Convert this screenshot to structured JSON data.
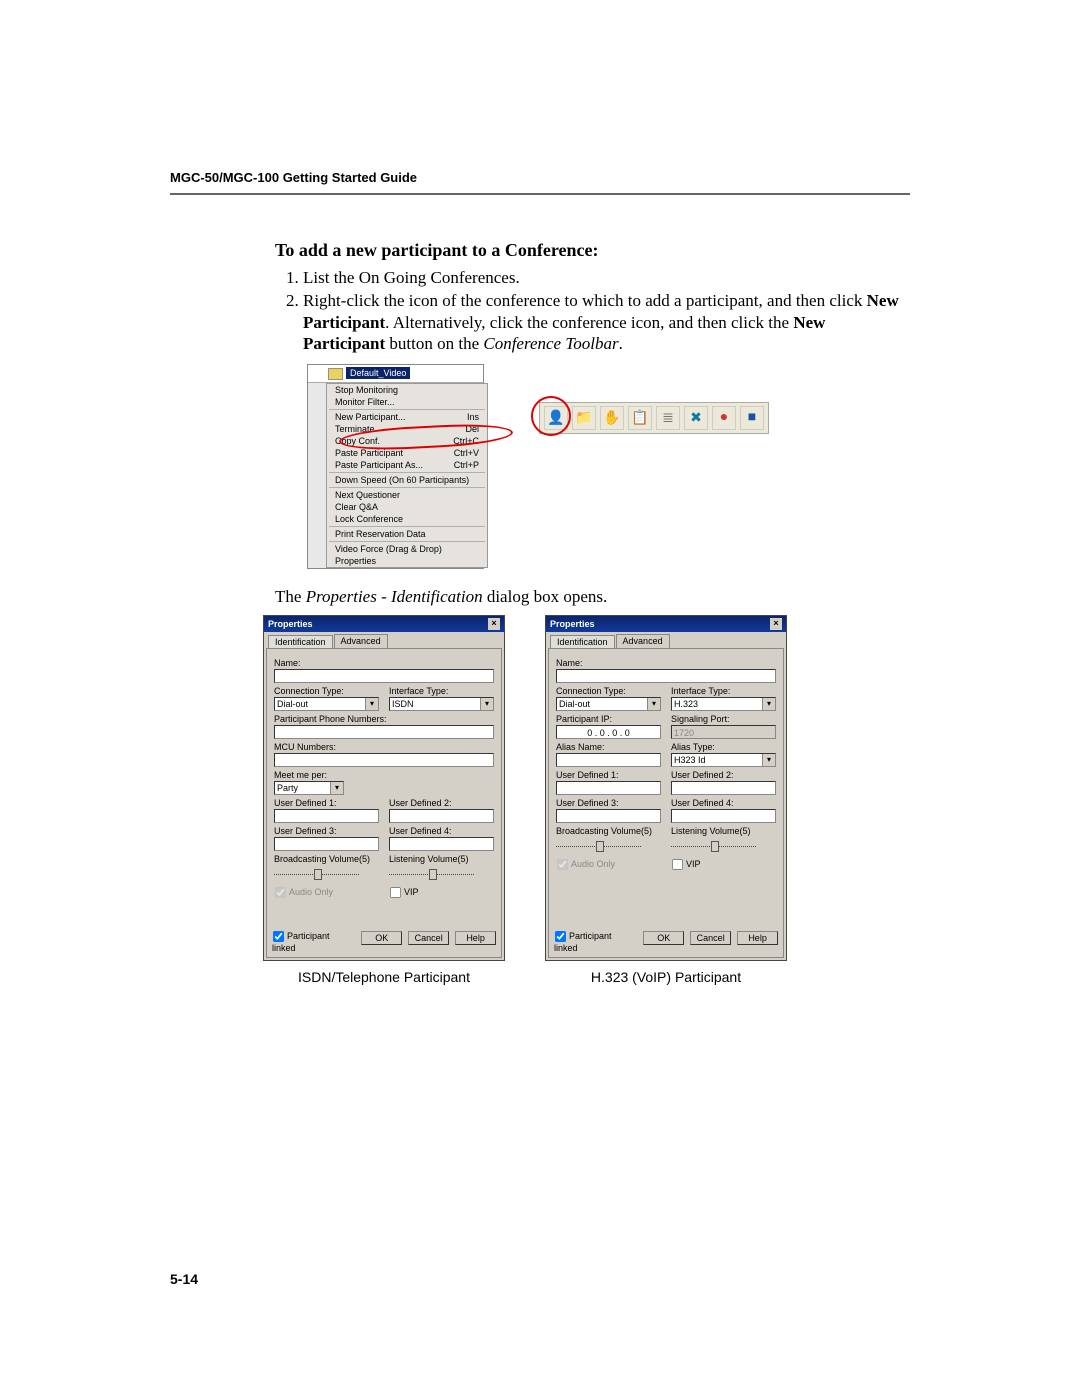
{
  "header": "MGC-50/MGC-100 Getting Started Guide",
  "section_heading": "To add a new participant to a Conference:",
  "step1": "List the On Going Conferences.",
  "step2_a": "Right-click the icon of the conference to which to add a participant, and then click ",
  "step2_b": "New Participant",
  "step2_c": ". Alternatively, click the conference icon, and then click the ",
  "step2_d": "New Participant",
  "step2_e": " button on the ",
  "step2_f": "Conference Toolbar",
  "step2_g": ".",
  "tree_selected": "Default_Video",
  "ctx": {
    "stop_monitoring": "Stop Monitoring",
    "monitor_filter": "Monitor Filter...",
    "new_participant": "New Participant...",
    "new_participant_sc": "Ins",
    "terminate": "Terminate",
    "terminate_sc": "Del",
    "copy_conf": "Copy Conf.",
    "copy_conf_sc": "Ctrl+C",
    "paste_participant": "Paste Participant",
    "paste_participant_sc": "Ctrl+V",
    "paste_participant_as": "Paste Participant As...",
    "paste_participant_as_sc": "Ctrl+P",
    "down_speed": "Down Speed (On 60 Participants)",
    "next_questioner": "Next Questioner",
    "clear_qa": "Clear Q&A",
    "lock_conference": "Lock Conference",
    "print_reservation": "Print Reservation Data",
    "video_force": "Video Force (Drag & Drop)",
    "properties": "Properties"
  },
  "toolbar_icons": {
    "participant": "participant-icon",
    "folder": "folder-icon",
    "hand": "hand-icon",
    "clipboard": "clipboard-icon",
    "bullet": "bullet-icon",
    "xpeople": "cross-people-icon",
    "circle": "red-circle-icon",
    "square": "blue-square-icon"
  },
  "dialog_opens_a": "The ",
  "dialog_opens_b": "Properties - Identification",
  "dialog_opens_c": " dialog box opens.",
  "dialog": {
    "title": "Properties",
    "tab_identification": "Identification",
    "tab_advanced": "Advanced",
    "name": "Name:",
    "connection_type": "Connection Type:",
    "dial_out": "Dial-out",
    "interface_type": "Interface Type:",
    "isdn": "ISDN",
    "h323": "H.323",
    "participant_phone": "Participant Phone Numbers:",
    "participant_ip": "Participant IP:",
    "ip_value": "0 . 0 . 0 . 0",
    "signaling_port": "Signaling Port:",
    "signaling_port_val": "1720",
    "mcu_numbers": "MCU Numbers:",
    "alias_name": "Alias Name:",
    "alias_type": "Alias Type:",
    "h323_id": "H323 Id",
    "meet_me_per": "Meet me per:",
    "party": "Party",
    "user_defined1": "User Defined 1:",
    "user_defined2": "User Defined 2:",
    "user_defined3": "User Defined 3:",
    "user_defined4": "User Defined 4:",
    "broadcasting_volume": "Broadcasting Volume(5)",
    "listening_volume": "Listening Volume(5)",
    "audio_only": "Audio Only",
    "vip": "VIP",
    "participant_linked": "Participant linked",
    "ok": "OK",
    "cancel": "Cancel",
    "help": "Help"
  },
  "caption_left": "ISDN/Telephone Participant",
  "caption_right": "H.323 (VoIP) Participant",
  "page_number": "5-14"
}
